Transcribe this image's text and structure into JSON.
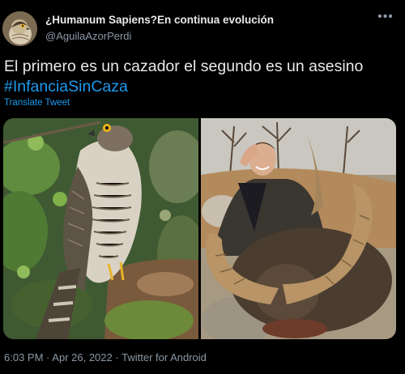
{
  "tweet": {
    "author": {
      "display_name": "¿Humanum Sapiens?En continua evolución",
      "handle": "@AguilaAzorPerdi",
      "avatar_icon": "hawk-avatar"
    },
    "text": "El primero es un cazador el segundo es un asesino",
    "hashtag": "#InfanciaSinCaza",
    "translate_label": "Translate Tweet",
    "media": {
      "left_image": "sparrowhawk-perched-on-mossy-stump",
      "right_image": "hunter-posing-with-horned-ibex-trophy"
    },
    "time": "6:03 PM",
    "date": "Apr 26, 2022",
    "source": "Twitter for Android",
    "separator": "·"
  },
  "colors": {
    "background": "#000000",
    "text": "#e7e9ea",
    "muted": "#8b98a5",
    "link": "#1d9bf0"
  }
}
